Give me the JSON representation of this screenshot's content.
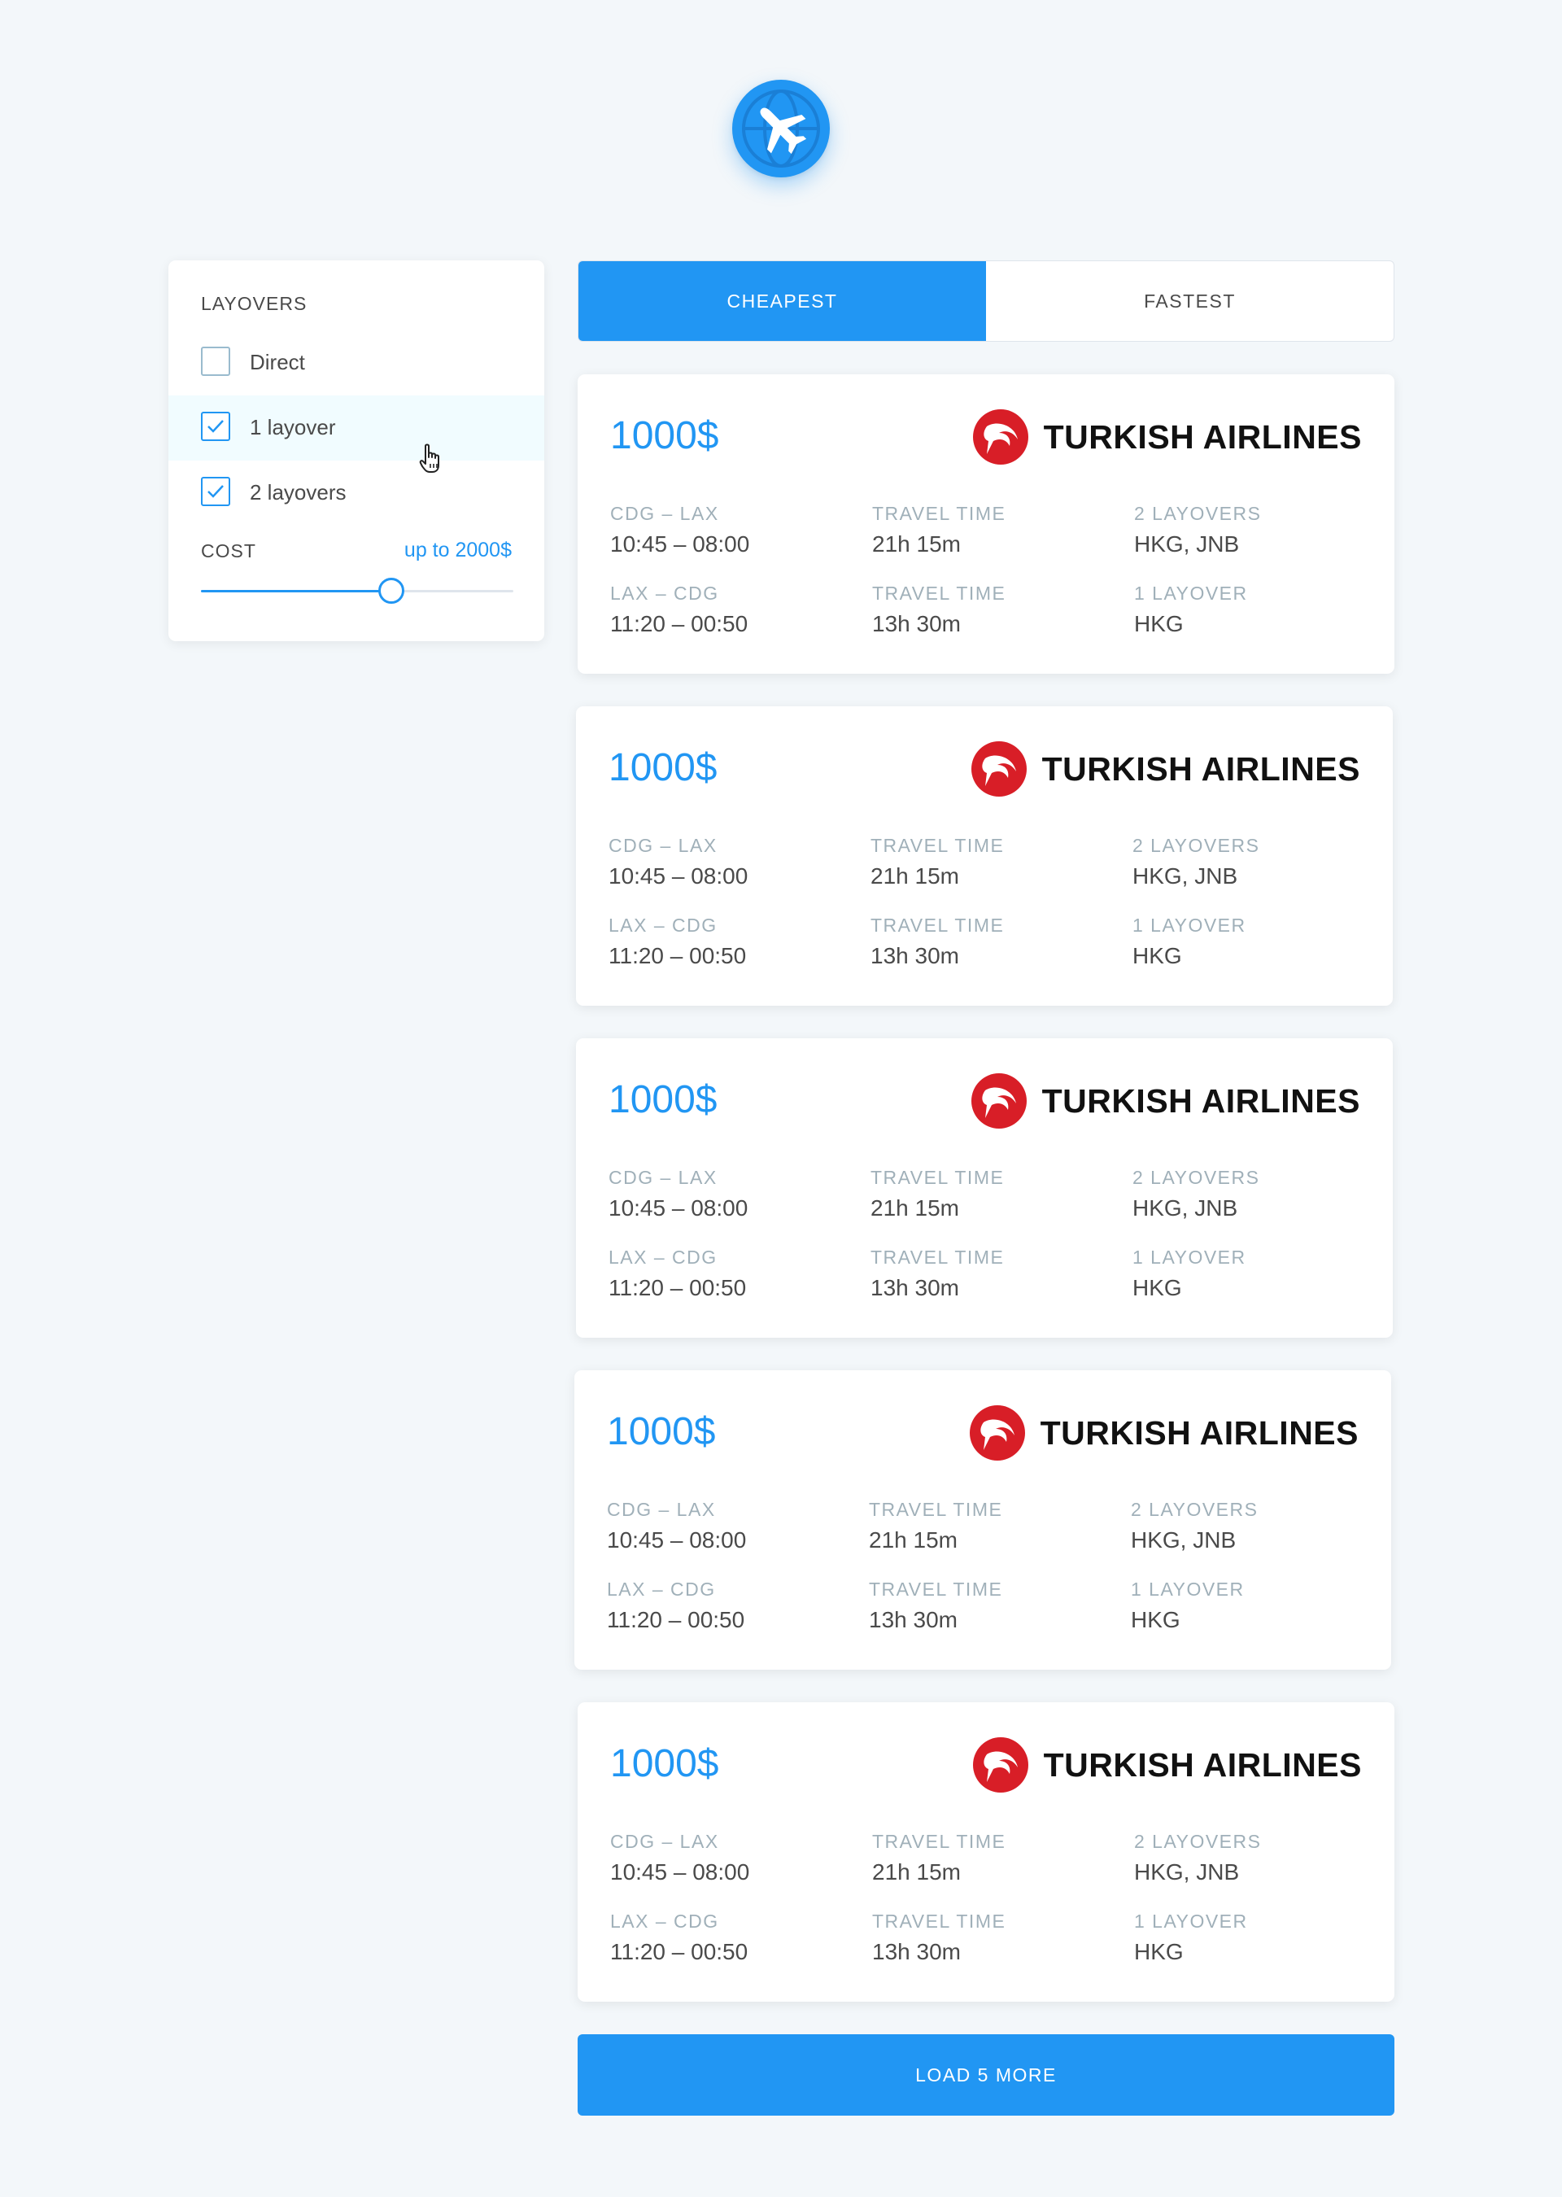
{
  "logo": {
    "icon": "airplane-globe-icon",
    "color": "#2196f3"
  },
  "filters": {
    "layovers_title": "LAYOVERS",
    "options": [
      {
        "label": "Direct",
        "checked": false
      },
      {
        "label": "1 layover",
        "checked": true
      },
      {
        "label": "2 layovers",
        "checked": true
      }
    ],
    "cost_title": "COST",
    "cost_value": "up to 2000$",
    "cost_slider_fraction": 0.61
  },
  "tabs": [
    {
      "label": "CHEAPEST",
      "active": true
    },
    {
      "label": "FASTEST",
      "active": false
    }
  ],
  "tickets": [
    {
      "price": "1000$",
      "airline": "TURKISH AIRLINES",
      "airline_icon": "turkish-airlines-logo-icon",
      "segments": [
        {
          "route": "CDG – LAX",
          "times": "10:45 – 08:00",
          "travel_label": "TRAVEL TIME",
          "duration": "21h 15m",
          "layover_label": "2 LAYOVERS",
          "layovers": "HKG, JNB"
        },
        {
          "route": "LAX – CDG",
          "times": "11:20 – 00:50",
          "travel_label": "TRAVEL TIME",
          "duration": "13h 30m",
          "layover_label": "1 LAYOVER",
          "layovers": "HKG"
        }
      ]
    },
    {
      "price": "1000$",
      "airline": "TURKISH AIRLINES",
      "airline_icon": "turkish-airlines-logo-icon",
      "segments": [
        {
          "route": "CDG – LAX",
          "times": "10:45 – 08:00",
          "travel_label": "TRAVEL TIME",
          "duration": "21h 15m",
          "layover_label": "2 LAYOVERS",
          "layovers": "HKG, JNB"
        },
        {
          "route": "LAX – CDG",
          "times": "11:20 – 00:50",
          "travel_label": "TRAVEL TIME",
          "duration": "13h 30m",
          "layover_label": "1 LAYOVER",
          "layovers": "HKG"
        }
      ]
    },
    {
      "price": "1000$",
      "airline": "TURKISH AIRLINES",
      "airline_icon": "turkish-airlines-logo-icon",
      "segments": [
        {
          "route": "CDG – LAX",
          "times": "10:45 – 08:00",
          "travel_label": "TRAVEL TIME",
          "duration": "21h 15m",
          "layover_label": "2 LAYOVERS",
          "layovers": "HKG, JNB"
        },
        {
          "route": "LAX – CDG",
          "times": "11:20 – 00:50",
          "travel_label": "TRAVEL TIME",
          "duration": "13h 30m",
          "layover_label": "1 LAYOVER",
          "layovers": "HKG"
        }
      ]
    },
    {
      "price": "1000$",
      "airline": "TURKISH AIRLINES",
      "airline_icon": "turkish-airlines-logo-icon",
      "segments": [
        {
          "route": "CDG – LAX",
          "times": "10:45 – 08:00",
          "travel_label": "TRAVEL TIME",
          "duration": "21h 15m",
          "layover_label": "2 LAYOVERS",
          "layovers": "HKG, JNB"
        },
        {
          "route": "LAX – CDG",
          "times": "11:20 – 00:50",
          "travel_label": "TRAVEL TIME",
          "duration": "13h 30m",
          "layover_label": "1 LAYOVER",
          "layovers": "HKG"
        }
      ]
    },
    {
      "price": "1000$",
      "airline": "TURKISH AIRLINES",
      "airline_icon": "turkish-airlines-logo-icon",
      "segments": [
        {
          "route": "CDG – LAX",
          "times": "10:45 – 08:00",
          "travel_label": "TRAVEL TIME",
          "duration": "21h 15m",
          "layover_label": "2 LAYOVERS",
          "layovers": "HKG, JNB"
        },
        {
          "route": "LAX – CDG",
          "times": "11:20 – 00:50",
          "travel_label": "TRAVEL TIME",
          "duration": "13h 30m",
          "layover_label": "1 LAYOVER",
          "layovers": "HKG"
        }
      ]
    }
  ],
  "load_more_label": "LOAD 5 MORE",
  "colors": {
    "accent": "#2196f3",
    "airline_red": "#d81e27",
    "muted": "#a0b0b9",
    "text": "#4a4a4a"
  }
}
